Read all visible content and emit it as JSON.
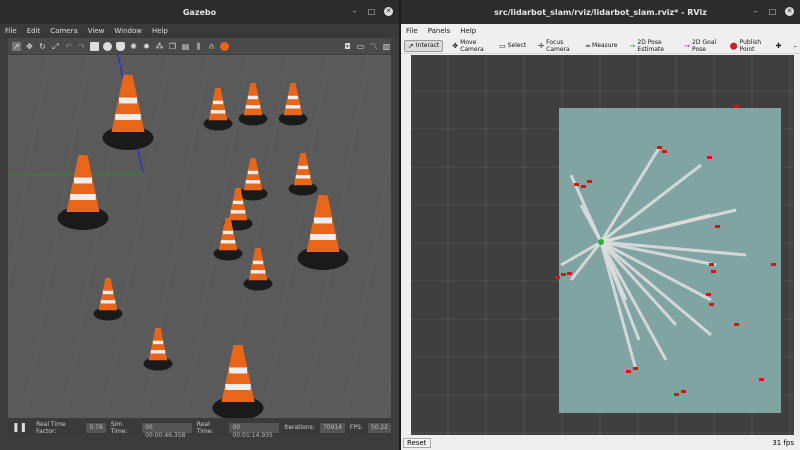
{
  "gazebo": {
    "title": "Gazebo",
    "menus": [
      "File",
      "Edit",
      "Camera",
      "View",
      "Window",
      "Help"
    ],
    "status": {
      "rtf_label": "Real Time Factor:",
      "rtf_value": "0.78",
      "sim_label": "Sim Time:",
      "sim_value": "00 00:00:46.358",
      "real_label": "Real Time:",
      "real_value": "00 00:01:14.935",
      "iter_label": "Iterations:",
      "iter_value": "70914",
      "fps_label": "FPS:",
      "fps_value": "50.22"
    }
  },
  "rviz": {
    "title": "src/lidarbot_slam/rviz/lidarbot_slam.rviz* - RViz",
    "menus": [
      "File",
      "Panels",
      "Help"
    ],
    "tools": [
      "Interact",
      "Move Camera",
      "Select",
      "Focus Camera",
      "Measure",
      "2D Pose Estimate",
      "2D Goal Pose",
      "Publish Point"
    ],
    "reset_label": "Reset",
    "fps": "31 fps"
  },
  "colors": {
    "cone_orange": "#e8661a",
    "map_free": "#dddddd",
    "map_unknown": "#7fa4a2",
    "scan_red": "#e01010"
  }
}
